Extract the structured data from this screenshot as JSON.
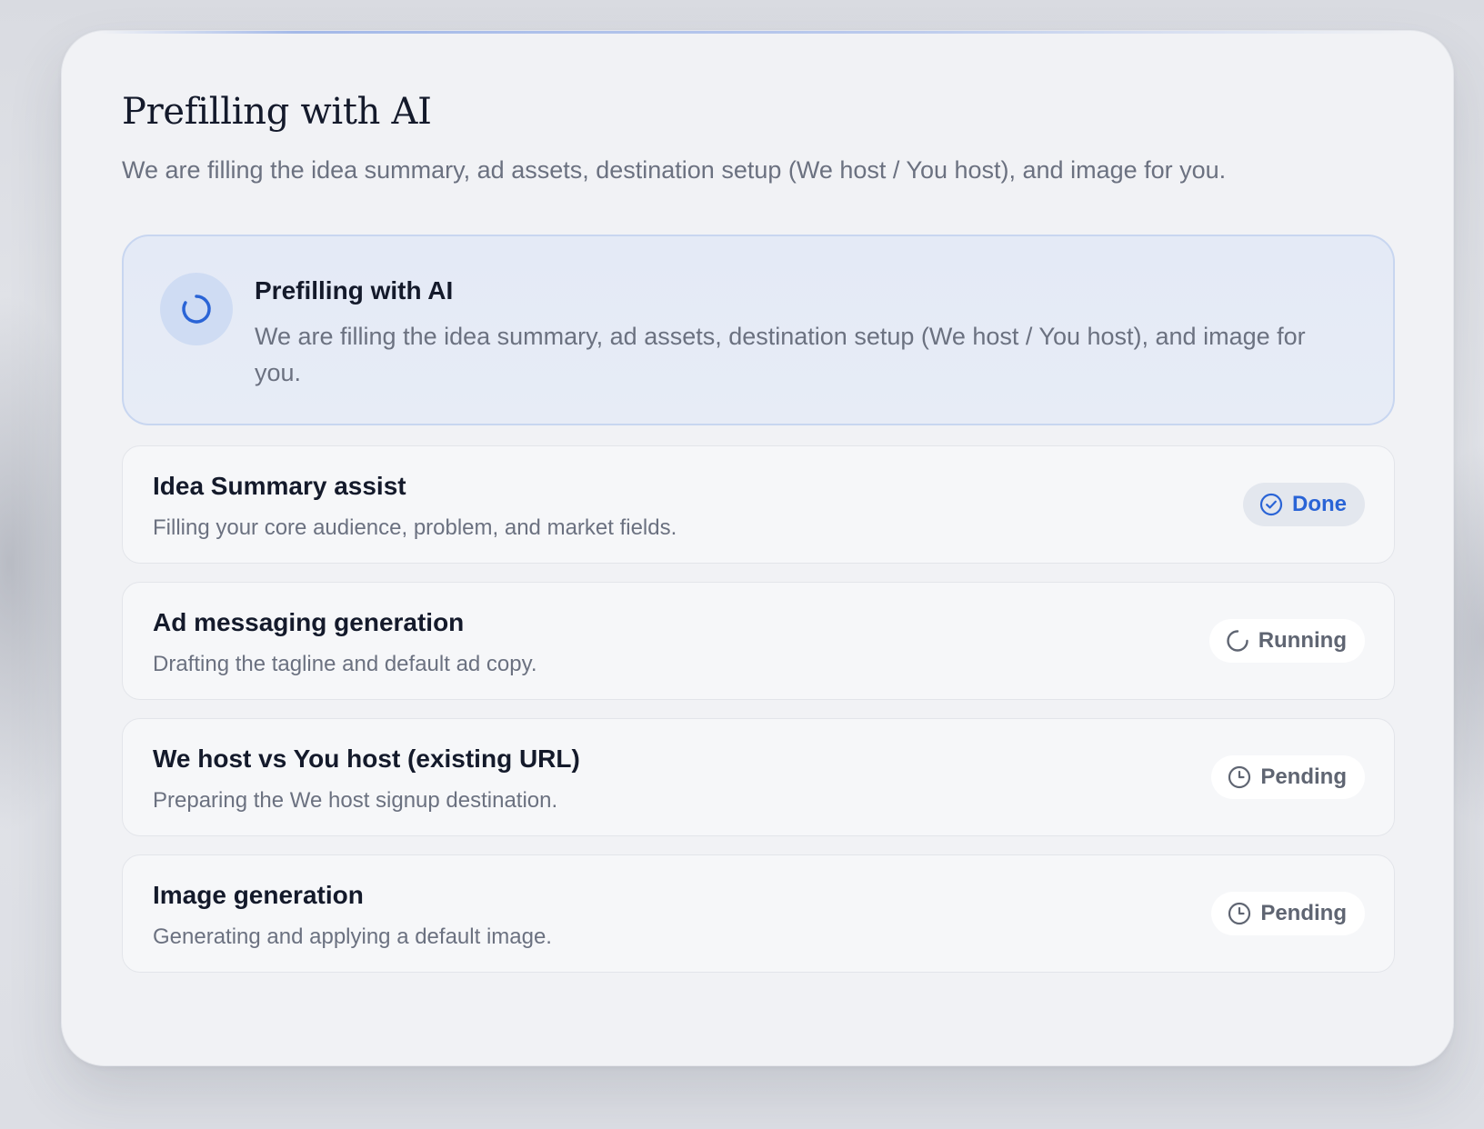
{
  "modal": {
    "title": "Prefilling with AI",
    "subtitle": "We are filling the idea summary, ad assets, destination setup (We host / You host), and image for you."
  },
  "status_panel": {
    "icon": "spinner-icon",
    "title": "Prefilling with AI",
    "description": "We are filling the idea summary, ad assets, destination setup (We host / You host), and image for you."
  },
  "tasks": [
    {
      "title": "Idea Summary assist",
      "description": "Filling your core audience, problem, and market fields.",
      "status": "Done",
      "status_icon": "check-circle-icon"
    },
    {
      "title": "Ad messaging generation",
      "description": "Drafting the tagline and default ad copy.",
      "status": "Running",
      "status_icon": "loading-icon"
    },
    {
      "title": "We host vs You host (existing URL)",
      "description": "Preparing the We host signup destination.",
      "status": "Pending",
      "status_icon": "clock-icon"
    },
    {
      "title": "Image generation",
      "description": "Generating and applying a default image.",
      "status": "Pending",
      "status_icon": "clock-icon"
    }
  ],
  "colors": {
    "accent": "#2a64d6",
    "panel_background": "#e4eaf6",
    "panel_border": "#c8d6f0",
    "muted_text": "#6b7180",
    "heading_text": "#141a2b"
  }
}
